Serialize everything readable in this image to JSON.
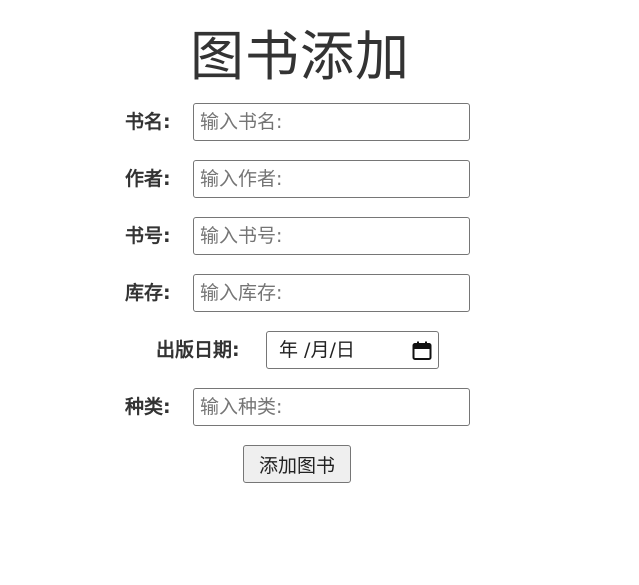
{
  "page": {
    "title": "图书添加"
  },
  "form": {
    "book_name": {
      "label": "书名:",
      "placeholder": "输入书名:",
      "value": ""
    },
    "author": {
      "label": "作者:",
      "placeholder": "输入作者:",
      "value": ""
    },
    "book_number": {
      "label": "书号:",
      "placeholder": "输入书号:",
      "value": ""
    },
    "stock": {
      "label": "库存:",
      "placeholder": "输入库存:",
      "value": ""
    },
    "publish_date": {
      "label": "出版日期:",
      "display": "年 /月/日",
      "icon": "calendar-icon"
    },
    "category": {
      "label": "种类:",
      "placeholder": "输入种类:",
      "value": ""
    },
    "submit_label": "添加图书"
  }
}
